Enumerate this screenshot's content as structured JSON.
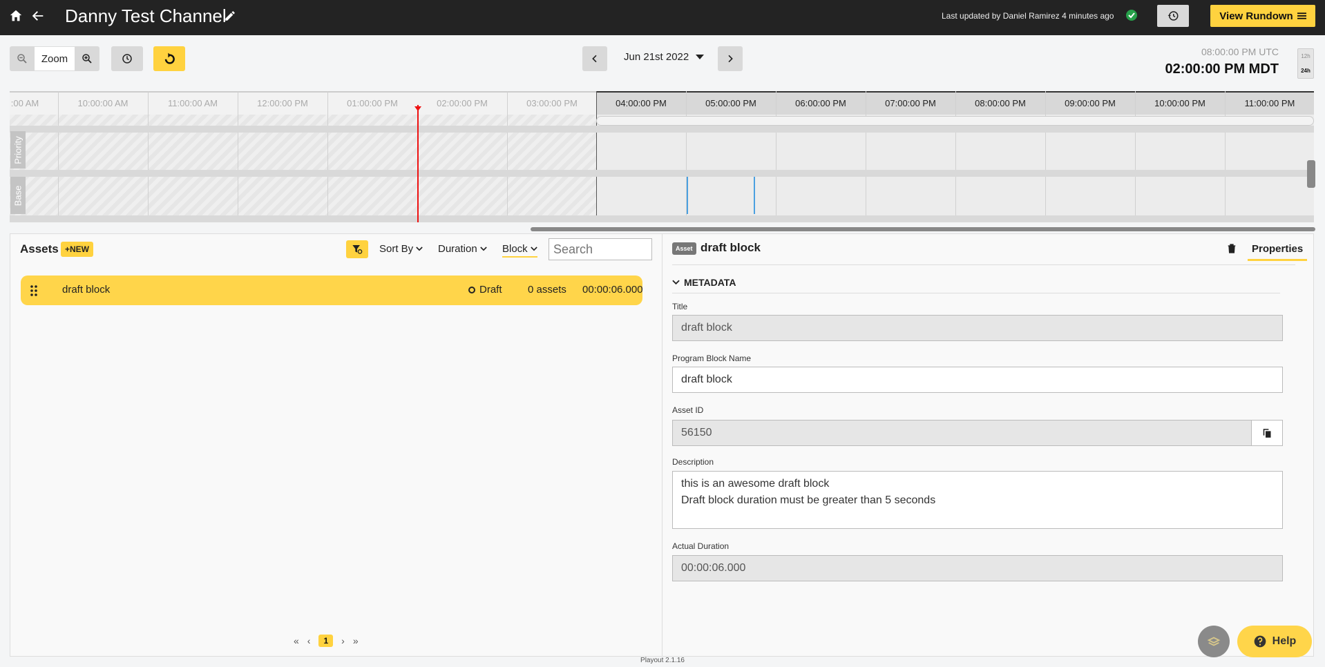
{
  "header": {
    "title": "Danny Test Channel",
    "last_updated": "Last updated by Daniel Ramirez 4 minutes ago",
    "view_rundown_label": "View Rundown",
    "accent_color": "#ffd23f"
  },
  "toolbar": {
    "zoom_label": "Zoom",
    "date_label": "Jun 21st 2022",
    "time_utc": "08:00:00 PM UTC",
    "time_local": "02:00:00 PM MDT",
    "hour_12": "12h",
    "hour_24": "24h"
  },
  "timeline": {
    "past_ticks": [
      ":00 AM",
      "10:00:00 AM",
      "11:00:00 AM",
      "12:00:00 PM",
      "01:00:00 PM",
      "02:00:00 PM",
      "03:00:00 PM"
    ],
    "future_ticks": [
      "04:00:00 PM",
      "05:00:00 PM",
      "06:00:00 PM",
      "07:00:00 PM",
      "08:00:00 PM",
      "09:00:00 PM",
      "10:00:00 PM",
      "11:00:00 PM"
    ],
    "row_labels": [
      "Priority",
      "Base"
    ]
  },
  "assets": {
    "title": "Assets",
    "new_label": "+NEW",
    "sort_by_label": "Sort By",
    "duration_label": "Duration",
    "block_label": "Block",
    "search_placeholder": "Search",
    "rows": [
      {
        "name": "draft block",
        "status": "Draft",
        "count": "0 assets",
        "duration": "00:00:06.000"
      }
    ],
    "pagination": {
      "current": "1"
    }
  },
  "properties": {
    "asset_tag": "Asset",
    "title": "draft block",
    "tab_label": "Properties",
    "section_label": "METADATA",
    "fields": {
      "title_label": "Title",
      "title_value": "draft block",
      "program_label": "Program Block Name",
      "program_value": "draft block",
      "asset_id_label": "Asset ID",
      "asset_id_value": "56150",
      "description_label": "Description",
      "description_line1": "this is an awesome draft block",
      "description_line2": "Draft block duration must be greater than 5 seconds",
      "actual_duration_label": "Actual Duration",
      "actual_duration_value": "00:00:06.000"
    }
  },
  "footer": {
    "version": "Playout 2.1.16",
    "help_label": "Help"
  }
}
